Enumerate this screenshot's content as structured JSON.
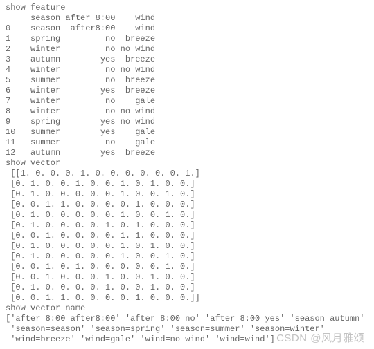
{
  "feature": {
    "heading": "show feature",
    "header_cols": [
      "season",
      "after 8:00",
      "wind"
    ],
    "cols": [
      "season",
      "after8:00",
      "wind"
    ],
    "rows": [
      {
        "idx": "0",
        "c0": "season",
        "c1": "after8:00",
        "c2": "wind"
      },
      {
        "idx": "1",
        "c0": "spring",
        "c1": "no",
        "c2": "breeze"
      },
      {
        "idx": "2",
        "c0": "winter",
        "c1": "no",
        "c2": "no wind"
      },
      {
        "idx": "3",
        "c0": "autumn",
        "c1": "yes",
        "c2": "breeze"
      },
      {
        "idx": "4",
        "c0": "winter",
        "c1": "no",
        "c2": "no wind"
      },
      {
        "idx": "5",
        "c0": "summer",
        "c1": "no",
        "c2": "breeze"
      },
      {
        "idx": "6",
        "c0": "winter",
        "c1": "yes",
        "c2": "breeze"
      },
      {
        "idx": "7",
        "c0": "winter",
        "c1": "no",
        "c2": "gale"
      },
      {
        "idx": "8",
        "c0": "winter",
        "c1": "no",
        "c2": "no wind"
      },
      {
        "idx": "9",
        "c0": "spring",
        "c1": "yes",
        "c2": "no wind"
      },
      {
        "idx": "10",
        "c0": "summer",
        "c1": "yes",
        "c2": "gale"
      },
      {
        "idx": "11",
        "c0": "summer",
        "c1": "no",
        "c2": "gale"
      },
      {
        "idx": "12",
        "c0": "autumn",
        "c1": "yes",
        "c2": "breeze"
      }
    ]
  },
  "vector": {
    "heading": "show vector",
    "rows": [
      [
        1,
        0,
        0,
        0,
        1,
        0,
        0,
        0,
        0,
        0,
        0,
        1
      ],
      [
        0,
        1,
        0,
        0,
        1,
        0,
        0,
        1,
        0,
        1,
        0,
        0
      ],
      [
        0,
        1,
        0,
        0,
        0,
        0,
        0,
        1,
        0,
        0,
        1,
        0
      ],
      [
        0,
        0,
        1,
        1,
        0,
        0,
        0,
        0,
        1,
        0,
        0,
        0
      ],
      [
        0,
        1,
        0,
        0,
        0,
        0,
        0,
        1,
        0,
        0,
        1,
        0
      ],
      [
        0,
        1,
        0,
        0,
        0,
        0,
        1,
        0,
        1,
        0,
        0,
        0
      ],
      [
        0,
        0,
        1,
        0,
        0,
        0,
        0,
        1,
        1,
        0,
        0,
        0
      ],
      [
        0,
        1,
        0,
        0,
        0,
        0,
        0,
        1,
        0,
        1,
        0,
        0
      ],
      [
        0,
        1,
        0,
        0,
        0,
        0,
        0,
        1,
        0,
        0,
        1,
        0
      ],
      [
        0,
        0,
        1,
        0,
        1,
        0,
        0,
        0,
        0,
        0,
        1,
        0
      ],
      [
        0,
        0,
        1,
        0,
        0,
        0,
        1,
        0,
        0,
        1,
        0,
        0
      ],
      [
        0,
        1,
        0,
        0,
        0,
        0,
        1,
        0,
        0,
        1,
        0,
        0
      ],
      [
        0,
        0,
        1,
        1,
        0,
        0,
        0,
        0,
        1,
        0,
        0,
        0
      ]
    ]
  },
  "names": {
    "heading": "show vector name",
    "items": [
      "after 8:00=after8:00",
      "after 8:00=no",
      "after 8:00=yes",
      "season=autumn",
      "season=season",
      "season=spring",
      "season=summer",
      "season=winter",
      "wind=breeze",
      "wind=gale",
      "wind=no wind",
      "wind=wind"
    ]
  },
  "watermark": "CSDN @风月雅颂"
}
